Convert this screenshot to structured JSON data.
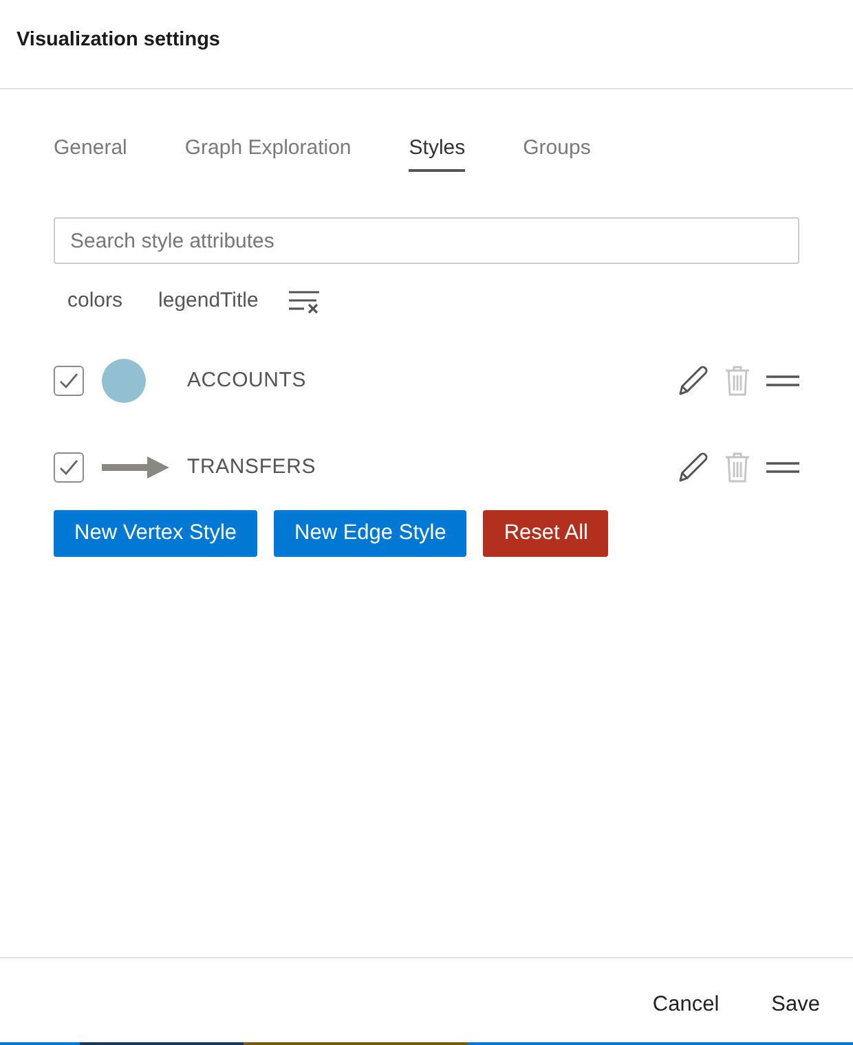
{
  "dialog": {
    "title": "Visualization settings"
  },
  "tabs": [
    {
      "label": "General",
      "selected": false
    },
    {
      "label": "Graph Exploration",
      "selected": false
    },
    {
      "label": "Styles",
      "selected": true
    },
    {
      "label": "Groups",
      "selected": false
    }
  ],
  "search": {
    "placeholder": "Search style attributes"
  },
  "filters": [
    {
      "label": "colors"
    },
    {
      "label": "legendTitle"
    }
  ],
  "styles": [
    {
      "kind": "vertex",
      "label": "ACCOUNTS",
      "checked": true,
      "color": "#92bfd2",
      "delete_disabled": true
    },
    {
      "kind": "edge",
      "label": "TRANSFERS",
      "checked": true,
      "color": "#8a8883",
      "delete_disabled": true
    }
  ],
  "actions": [
    {
      "kind": "primary",
      "label": "New Vertex Style"
    },
    {
      "kind": "primary",
      "label": "New Edge Style"
    },
    {
      "kind": "danger",
      "label": "Reset All"
    }
  ],
  "footer": {
    "buttons": [
      "Cancel",
      "Save"
    ]
  }
}
